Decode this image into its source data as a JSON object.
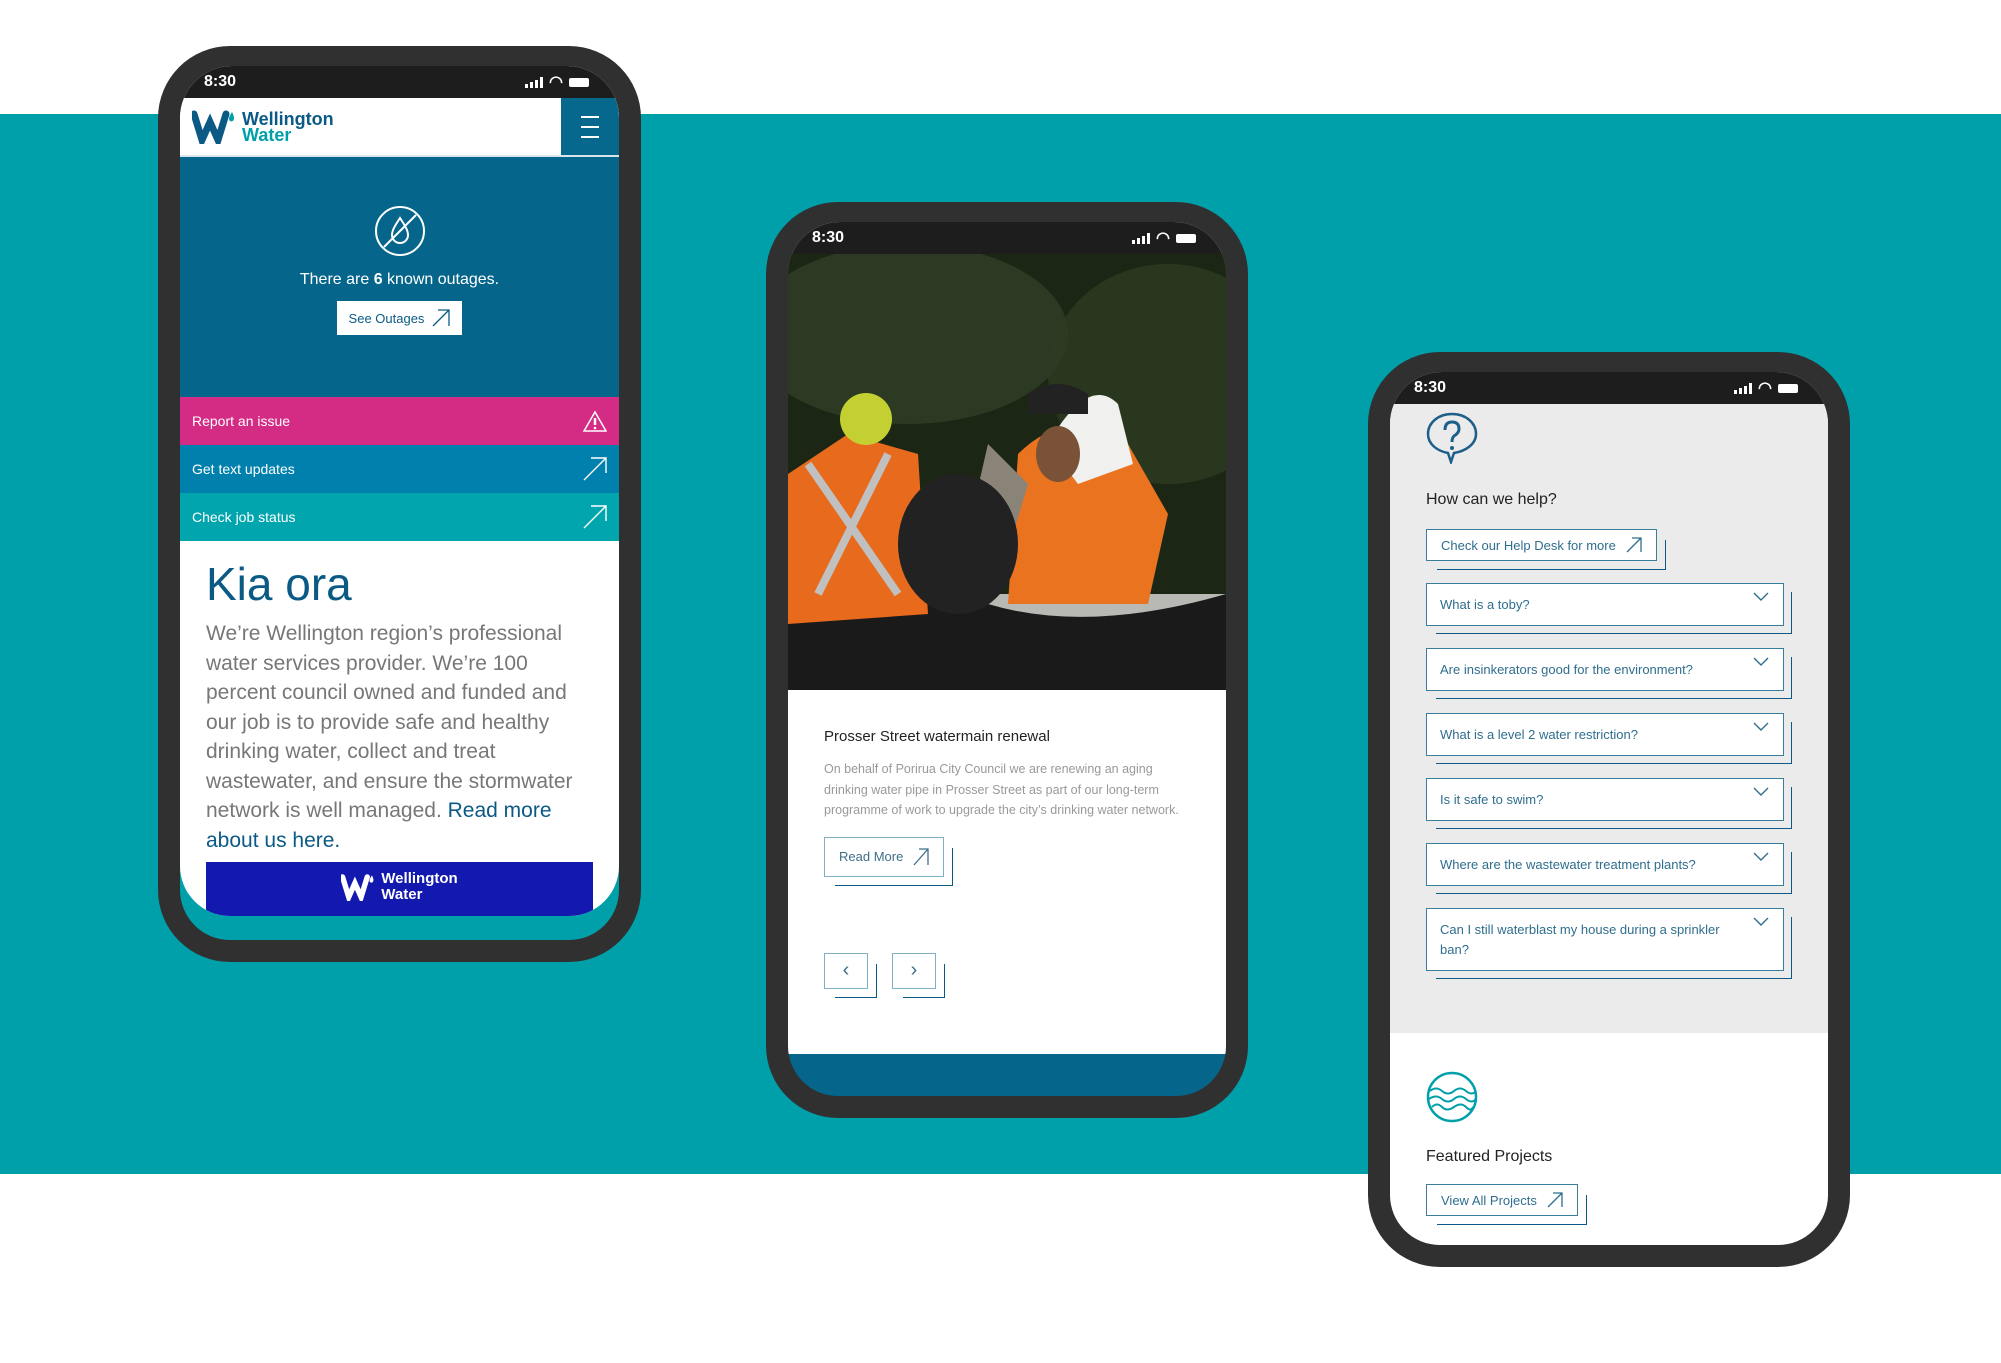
{
  "colors": {
    "teal_band": "#00a0aa",
    "navy": "#05658a",
    "pink": "#d42b85",
    "blue_link": "#0080ad",
    "teal_link": "#00a5ad",
    "footer_blue": "#1318ae",
    "phone_frame": "#303030"
  },
  "status_time": "8:30",
  "phone1": {
    "logo": {
      "line1": "Wellington",
      "line2": "Water"
    },
    "hero": {
      "icon": "no-water-drop-icon",
      "text_pre": "There are ",
      "count": "6",
      "text_post": " known outages.",
      "button": "See Outages"
    },
    "quick_links": [
      {
        "label": "Report an issue",
        "icon": "warning-icon",
        "color": "#d42b85"
      },
      {
        "label": "Get text updates",
        "icon": "arrow-up-right-icon",
        "color": "#0080ad"
      },
      {
        "label": "Check job status",
        "icon": "arrow-up-right-icon",
        "color": "#00a5ad"
      }
    ],
    "heading": "Kia ora",
    "body": "We’re Wellington region’s professional water services provider. We’re 100 percent council owned and funded and our job is to provide safe and healthy drinking water, collect and treat wastewater, and ensure the stormwater network is well managed. ",
    "body_link": "Read more about us here.",
    "footer_logo": {
      "line1": "Wellington",
      "line2": "Water"
    }
  },
  "phone2": {
    "title": "Prosser Street watermain renewal",
    "body": "On behalf of Porirua City Council we are renewing an aging drinking water pipe in Prosser Street as part of our long-term programme of work to upgrade the city’s drinking water network.",
    "read_more": "Read More",
    "prev": "‹",
    "next": "›"
  },
  "phone3": {
    "help_heading": "How can we help?",
    "help_button": "Check our Help Desk for more",
    "faqs": [
      "What is a toby?",
      "Are insinkerators good for the environment?",
      "What is a level 2 water restriction?",
      "Is it safe to swim?",
      "Where are the wastewater treatment plants?",
      "Can I still waterblast my house during a sprinkler ban?"
    ],
    "projects_heading": "Featured Projects",
    "projects_button": "View All Projects"
  }
}
